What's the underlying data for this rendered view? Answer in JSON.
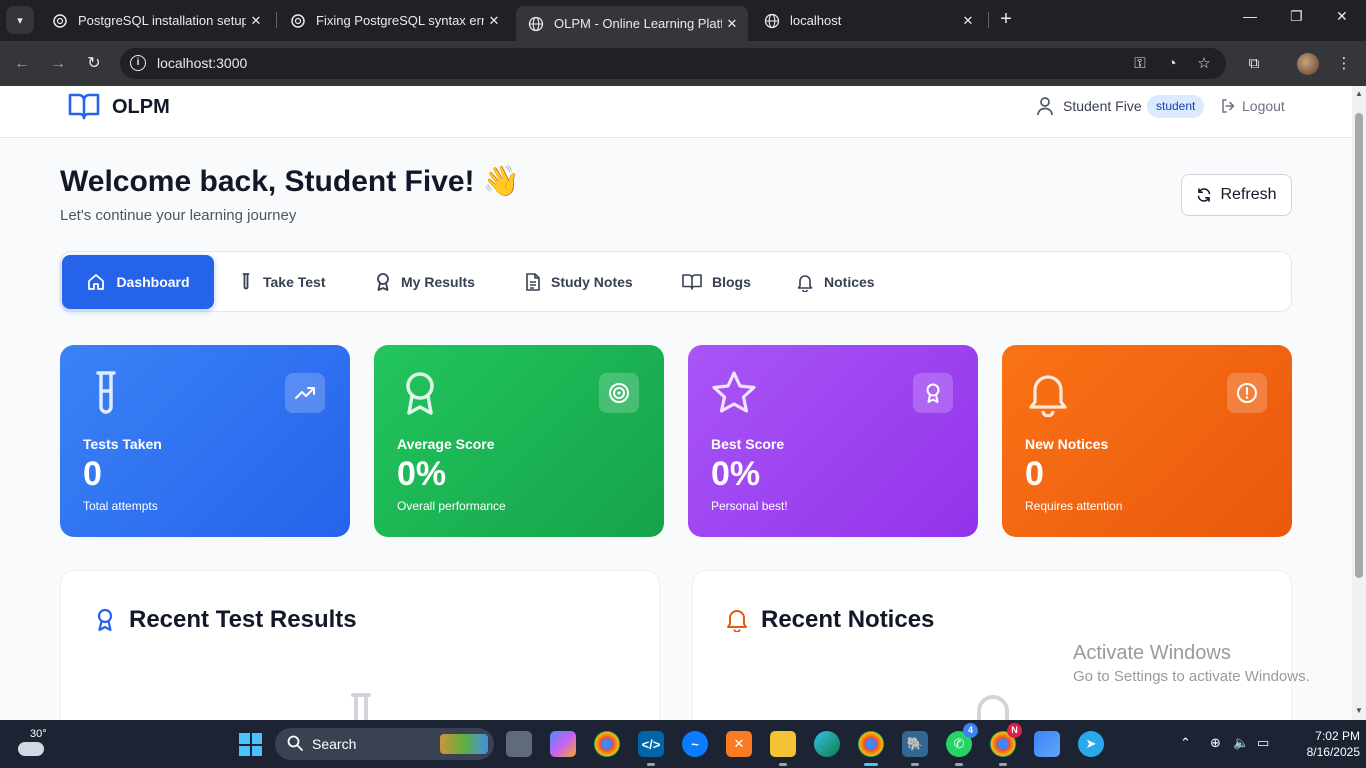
{
  "browser": {
    "tabs": [
      {
        "title": "PostgreSQL installation setup",
        "active": false
      },
      {
        "title": "Fixing PostgreSQL syntax error",
        "active": false
      },
      {
        "title": "OLPM - Online Learning Platform",
        "active": true
      },
      {
        "title": "localhost",
        "active": false
      }
    ],
    "url": "localhost:3000"
  },
  "header": {
    "logo_text": "OLPM",
    "user_name": "Student Five",
    "role": "student",
    "logout_label": "Logout"
  },
  "welcome": {
    "title": "Welcome back, Student Five! 👋",
    "subtitle": "Let's continue your learning journey",
    "refresh_label": "Refresh"
  },
  "nav": {
    "items": [
      {
        "label": "Dashboard",
        "icon": "home-icon",
        "active": true
      },
      {
        "label": "Take Test",
        "icon": "test-tube-icon",
        "active": false
      },
      {
        "label": "My Results",
        "icon": "award-icon",
        "active": false
      },
      {
        "label": "Study Notes",
        "icon": "file-text-icon",
        "active": false
      },
      {
        "label": "Blogs",
        "icon": "book-open-icon",
        "active": false
      },
      {
        "label": "Notices",
        "icon": "bell-icon",
        "active": false
      }
    ]
  },
  "stats": [
    {
      "label": "Tests Taken",
      "value": "0",
      "caption": "Total attempts",
      "icon": "test-tube-icon",
      "badge_icon": "trending-up-icon",
      "color_from": "#3b82f6",
      "color_to": "#2563eb"
    },
    {
      "label": "Average Score",
      "value": "0%",
      "caption": "Overall performance",
      "icon": "award-icon",
      "badge_icon": "target-icon",
      "color_from": "#22c55e",
      "color_to": "#16a34a"
    },
    {
      "label": "Best Score",
      "value": "0%",
      "caption": "Personal best!",
      "icon": "star-icon",
      "badge_icon": "award-icon",
      "color_from": "#a855f7",
      "color_to": "#9333ea"
    },
    {
      "label": "New Notices",
      "value": "0",
      "caption": "Requires attention",
      "icon": "bell-icon",
      "badge_icon": "alert-circle-icon",
      "color_from": "#f97316",
      "color_to": "#ea580c"
    }
  ],
  "panels": {
    "results_title": "Recent Test Results",
    "notices_title": "Recent Notices"
  },
  "watermark": {
    "line1": "Activate Windows",
    "line2": "Go to Settings to activate Windows."
  },
  "taskbar": {
    "temperature": "30°",
    "search_label": "Search",
    "time": "7:02 PM",
    "date": "8/16/2025",
    "whatsapp_badge": "4",
    "chrome_profile_badge": "N"
  }
}
